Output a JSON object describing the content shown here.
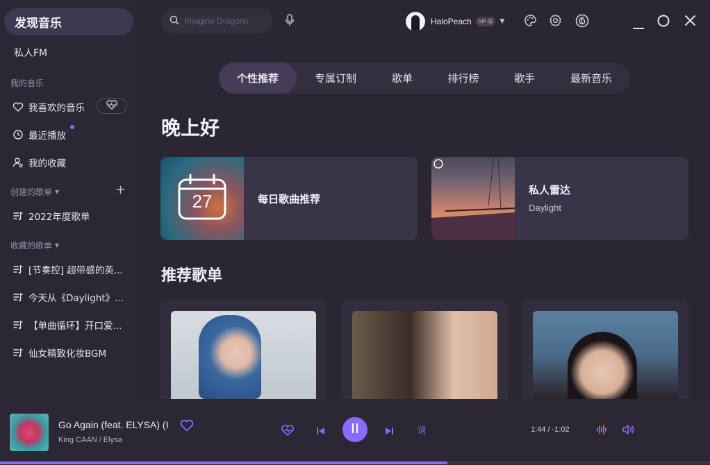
{
  "sidebar": {
    "discover": "发现音乐",
    "fm": "私人FM",
    "my_music_title": "我的音乐",
    "liked": "我喜欢的音乐",
    "recent": "最近播放",
    "collections": "我的收藏",
    "created_title": "创建的歌单",
    "created": [
      "2022年度歌单"
    ],
    "fav_title": "收藏的歌单",
    "favorites": [
      "[节奏控] 超带感的英...",
      "今天从《Daylight》...",
      "【单曲循环】开口爱...",
      "仙女精致化妆BGM"
    ]
  },
  "search": {
    "placeholder": "Imagine Dragons"
  },
  "user": {
    "name": "HaloPeach",
    "badge": "VIP·柒"
  },
  "tabs": [
    "个性推荐",
    "专属订制",
    "歌单",
    "排行榜",
    "歌手",
    "最新音乐"
  ],
  "greeting": "晚上好",
  "cards": {
    "daily": {
      "title": "每日歌曲推荐",
      "day": "27"
    },
    "radar": {
      "title": "私人雷达",
      "subtitle": "Daylight"
    }
  },
  "playlists_title": "推荐歌单",
  "player": {
    "title": "Go Again (feat. ELYSA) (I",
    "artist": "King CAAN / Elysa",
    "time": "1:44 / -1:02",
    "lyric_label": "词",
    "progress": 0.63
  },
  "colors": {
    "accent": "#8a6bff",
    "background": "#2a2633"
  },
  "icons": [
    "search-icon",
    "mic-icon",
    "palette-icon",
    "gear-icon",
    "netease-icon",
    "minimize-icon",
    "maximize-icon",
    "close-icon"
  ]
}
